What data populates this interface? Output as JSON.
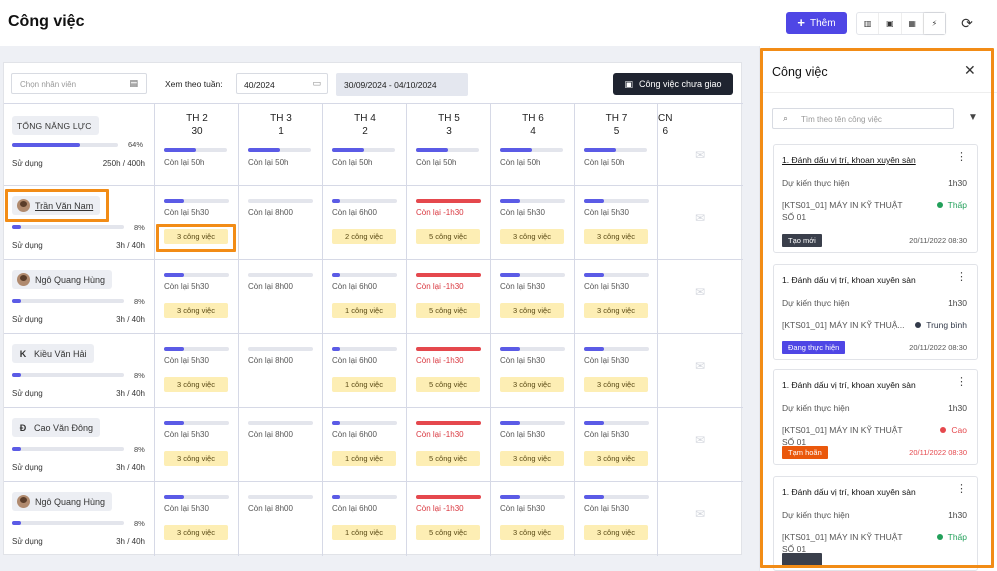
{
  "header": {
    "title": "Công việc",
    "add_label": "Thêm",
    "view_icons": [
      "columns-icon",
      "calendar-icon",
      "grid-icon",
      "lightning-icon"
    ],
    "refresh_icon": "refresh-icon"
  },
  "filters": {
    "employee_placeholder": "Chọn nhân viên",
    "week_label": "Xem theo tuần:",
    "week_value": "40/2024",
    "date_range": "30/09/2024 - 04/10/2024",
    "unassigned_button": "Công việc chưa giao"
  },
  "summary": {
    "label": "TỔNG NĂNG LỰC",
    "percent": "64%",
    "percent_value": 64,
    "usage_label": "Sử dụng",
    "usage_value": "250h / 400h"
  },
  "days": [
    {
      "name": "TH 2",
      "num": "30",
      "remain": "Còn lại 50h",
      "fill": 0.5
    },
    {
      "name": "TH 3",
      "num": "1",
      "remain": "Còn lại 50h",
      "fill": 0.5
    },
    {
      "name": "TH 4",
      "num": "2",
      "remain": "Còn lại 50h",
      "fill": 0.5
    },
    {
      "name": "TH 5",
      "num": "3",
      "remain": "Còn lại 50h",
      "fill": 0.5
    },
    {
      "name": "TH 6",
      "num": "4",
      "remain": "Còn lại 50h",
      "fill": 0.5
    },
    {
      "name": "TH 7",
      "num": "5",
      "remain": "Còn lại 50h",
      "fill": 0.5
    },
    {
      "name": "CN",
      "num": "6",
      "remain": "",
      "fill": 0
    }
  ],
  "employees": [
    {
      "name": "Trần Văn Nam",
      "avatar": "photo",
      "percent": "8%",
      "usage_label": "Sử dụng",
      "usage": "3h / 40h",
      "cells": [
        {
          "remain": "Còn lại 5h30",
          "badge": "3 công việc",
          "fill": 0.3,
          "red": false
        },
        {
          "remain": "Còn lại 8h00",
          "badge": "",
          "fill": 0,
          "red": false
        },
        {
          "remain": "Còn lại 6h00",
          "badge": "2 công việc",
          "fill": 0.12,
          "red": false
        },
        {
          "remain": "Còn lại -1h30",
          "badge": "5 công việc",
          "fill": 1,
          "red": true
        },
        {
          "remain": "Còn lại 5h30",
          "badge": "3 công việc",
          "fill": 0.3,
          "red": false
        },
        {
          "remain": "Còn lại 5h30",
          "badge": "3 công việc",
          "fill": 0.3,
          "red": false
        }
      ]
    },
    {
      "name": "Ngô Quang Hùng",
      "avatar": "photo",
      "percent": "8%",
      "usage_label": "Sử dụng",
      "usage": "3h / 40h",
      "cells": [
        {
          "remain": "Còn lại 5h30",
          "badge": "3 công việc",
          "fill": 0.3,
          "red": false
        },
        {
          "remain": "Còn lại 8h00",
          "badge": "",
          "fill": 0,
          "red": false
        },
        {
          "remain": "Còn lại 6h00",
          "badge": "1 công việc",
          "fill": 0.12,
          "red": false
        },
        {
          "remain": "Còn lại -1h30",
          "badge": "5 công việc",
          "fill": 1,
          "red": true
        },
        {
          "remain": "Còn lại 5h30",
          "badge": "3 công việc",
          "fill": 0.3,
          "red": false
        },
        {
          "remain": "Còn lại 5h30",
          "badge": "3 công việc",
          "fill": 0.3,
          "red": false
        }
      ]
    },
    {
      "name": "Kiều Văn Hải",
      "avatar": "K",
      "percent": "8%",
      "usage_label": "Sử dụng",
      "usage": "3h / 40h",
      "cells": [
        {
          "remain": "Còn lại 5h30",
          "badge": "3 công việc",
          "fill": 0.3,
          "red": false
        },
        {
          "remain": "Còn lại 8h00",
          "badge": "",
          "fill": 0,
          "red": false
        },
        {
          "remain": "Còn lại 6h00",
          "badge": "1 công việc",
          "fill": 0.12,
          "red": false
        },
        {
          "remain": "Còn lại -1h30",
          "badge": "5 công việc",
          "fill": 1,
          "red": true
        },
        {
          "remain": "Còn lại 5h30",
          "badge": "3 công việc",
          "fill": 0.3,
          "red": false
        },
        {
          "remain": "Còn lại 5h30",
          "badge": "3 công việc",
          "fill": 0.3,
          "red": false
        }
      ]
    },
    {
      "name": "Cao Văn Đông",
      "avatar": "Đ",
      "percent": "8%",
      "usage_label": "Sử dụng",
      "usage": "3h / 40h",
      "cells": [
        {
          "remain": "Còn lại 5h30",
          "badge": "3 công việc",
          "fill": 0.3,
          "red": false
        },
        {
          "remain": "Còn lại 8h00",
          "badge": "",
          "fill": 0,
          "red": false
        },
        {
          "remain": "Còn lại 6h00",
          "badge": "1 công việc",
          "fill": 0.12,
          "red": false
        },
        {
          "remain": "Còn lại -1h30",
          "badge": "5 công việc",
          "fill": 1,
          "red": true
        },
        {
          "remain": "Còn lại 5h30",
          "badge": "3 công việc",
          "fill": 0.3,
          "red": false
        },
        {
          "remain": "Còn lại 5h30",
          "badge": "3 công việc",
          "fill": 0.3,
          "red": false
        }
      ]
    },
    {
      "name": "Ngô Quang Hùng",
      "avatar": "photo",
      "percent": "8%",
      "usage_label": "Sử dụng",
      "usage": "3h / 40h",
      "cells": [
        {
          "remain": "Còn lại 5h30",
          "badge": "3 công việc",
          "fill": 0.3,
          "red": false
        },
        {
          "remain": "Còn lại 8h00",
          "badge": "",
          "fill": 0,
          "red": false
        },
        {
          "remain": "Còn lại 6h00",
          "badge": "1 công việc",
          "fill": 0.12,
          "red": false
        },
        {
          "remain": "Còn lại -1h30",
          "badge": "5 công việc",
          "fill": 1,
          "red": true
        },
        {
          "remain": "Còn lại 5h30",
          "badge": "3 công việc",
          "fill": 0.3,
          "red": false
        },
        {
          "remain": "Còn lại 5h30",
          "badge": "3 công việc",
          "fill": 0.3,
          "red": false
        }
      ]
    }
  ],
  "side_panel": {
    "title": "Công việc",
    "search_placeholder": "Tìm theo tên công việc",
    "tasks": [
      {
        "title": "1. Đánh dấu vị trí, khoan xuyên sàn",
        "expected_label": "Dự kiến thực hiện",
        "duration": "1h30",
        "dept": "[KTS01_01] MÁY IN KỸ THUẬT SỐ 01",
        "priority": "Thấp",
        "priority_color": "#22a05a",
        "status": "Tạo mới",
        "status_color": "#3a3f4b",
        "date": "20/11/2022 08:30",
        "date_color": "#555555"
      },
      {
        "title": "1. Đánh dấu vị trí, khoan xuyên sàn",
        "expected_label": "Dự kiến thực hiện",
        "duration": "1h30",
        "dept": "[KTS01_01] MÁY IN KỸ THUẬ...",
        "priority": "Trung bình",
        "priority_color": "#333a4a",
        "status": "Đang thực hiện",
        "status_color": "#4f46e5",
        "date": "20/11/2022 08:30",
        "date_color": "#555555"
      },
      {
        "title": "1. Đánh dấu vị trí, khoan xuyên sàn",
        "expected_label": "Dự kiến thực hiện",
        "duration": "1h30",
        "dept": "[KTS01_01] MÁY IN KỸ THUẬT SỐ 01",
        "priority": "Cao",
        "priority_color": "#e5484d",
        "status": "Tạm hoãn",
        "status_color": "#ea580c",
        "date": "20/11/2022 08:30",
        "date_color": "#e5484d"
      },
      {
        "title": "1. Đánh dấu vị trí, khoan xuyên sàn",
        "expected_label": "Dự kiến thực hiện",
        "duration": "1h30",
        "dept": "[KTS01_01] MÁY IN KỸ THUẬT SỐ 01",
        "priority": "Thấp",
        "priority_color": "#22a05a",
        "status": "",
        "status_color": "#3a3f4b",
        "date": "",
        "date_color": "#555555"
      }
    ]
  },
  "colors": {
    "accent": "#4f46e5",
    "highlight": "#f28c16",
    "over": "#e5484d",
    "badge": "#fdeeb4"
  }
}
